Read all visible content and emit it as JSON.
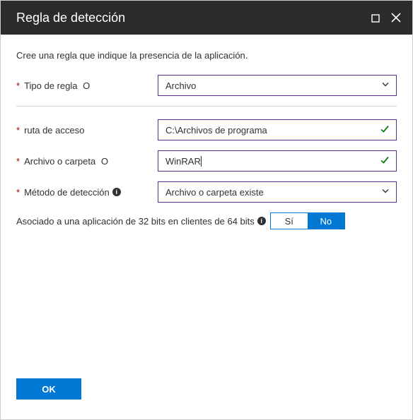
{
  "header": {
    "title": "Regla de detección"
  },
  "instruction": "Cree una regla que indique la presencia de la aplicación.",
  "fields": {
    "ruleType": {
      "label": "Tipo de regla",
      "value": "Archivo"
    },
    "path": {
      "label": "ruta de acceso",
      "value": "C:\\Archivos de programa"
    },
    "fileOrFolder": {
      "label": "Archivo o carpeta",
      "value": "WinRAR"
    },
    "detectionMethod": {
      "label": "Método de detección",
      "value": "Archivo o carpeta existe"
    }
  },
  "toggle": {
    "label": "Asociado a una aplicación de 32 bits en clientes de 64 bits",
    "options": {
      "yes": "Sí",
      "no": "No"
    },
    "selected": "no"
  },
  "footer": {
    "ok": "OK"
  }
}
